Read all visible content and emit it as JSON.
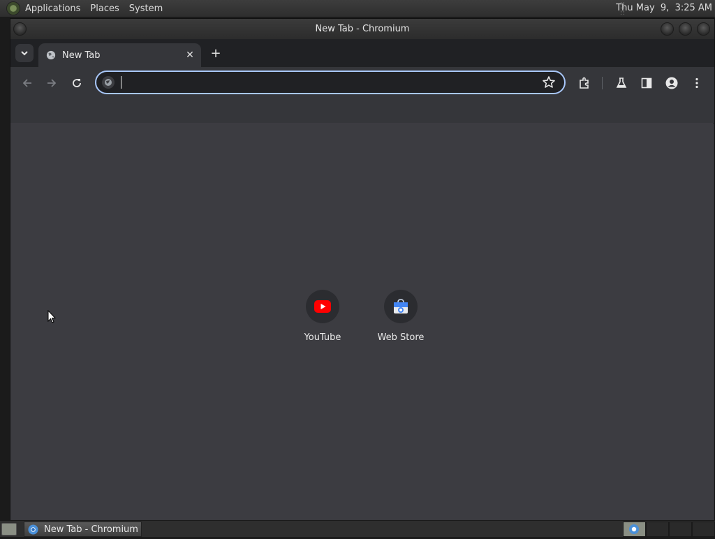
{
  "top_panel": {
    "menus": [
      "Applications",
      "Places",
      "System"
    ],
    "clock": "Thu May  9,  3:25 AM"
  },
  "window": {
    "title": "New Tab - Chromium"
  },
  "tabs": [
    {
      "title": "New Tab"
    }
  ],
  "omnibox": {
    "value": "",
    "placeholder": ""
  },
  "shortcuts": [
    {
      "label": "YouTube",
      "icon": "youtube-icon",
      "color": "#ff0000"
    },
    {
      "label": "Web Store",
      "icon": "web-store-icon",
      "color": "#4285f4"
    }
  ],
  "taskbar": {
    "task_label": "New Tab - Chromium"
  },
  "colors": {
    "ntp_background": "#3c3c41",
    "omnibox_focus": "#a8c7fa"
  }
}
